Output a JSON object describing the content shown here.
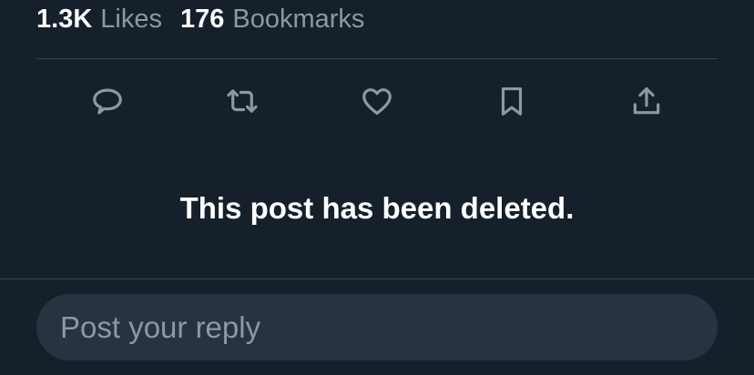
{
  "stats": {
    "likes": {
      "count": "1.3K",
      "label": "Likes"
    },
    "bookmarks": {
      "count": "176",
      "label": "Bookmarks"
    }
  },
  "actions": [
    {
      "name": "reply",
      "icon": "comment-icon"
    },
    {
      "name": "repost",
      "icon": "retweet-icon"
    },
    {
      "name": "like",
      "icon": "heart-icon"
    },
    {
      "name": "bookmark",
      "icon": "bookmark-icon"
    },
    {
      "name": "share",
      "icon": "share-icon"
    }
  ],
  "deleted_message": "This post has been deleted.",
  "reply": {
    "value": "",
    "placeholder": "Post your reply"
  },
  "colors": {
    "background": "#15202b",
    "muted_text": "#8b98a5",
    "divider": "#38444d",
    "reply_box": "#273340"
  }
}
